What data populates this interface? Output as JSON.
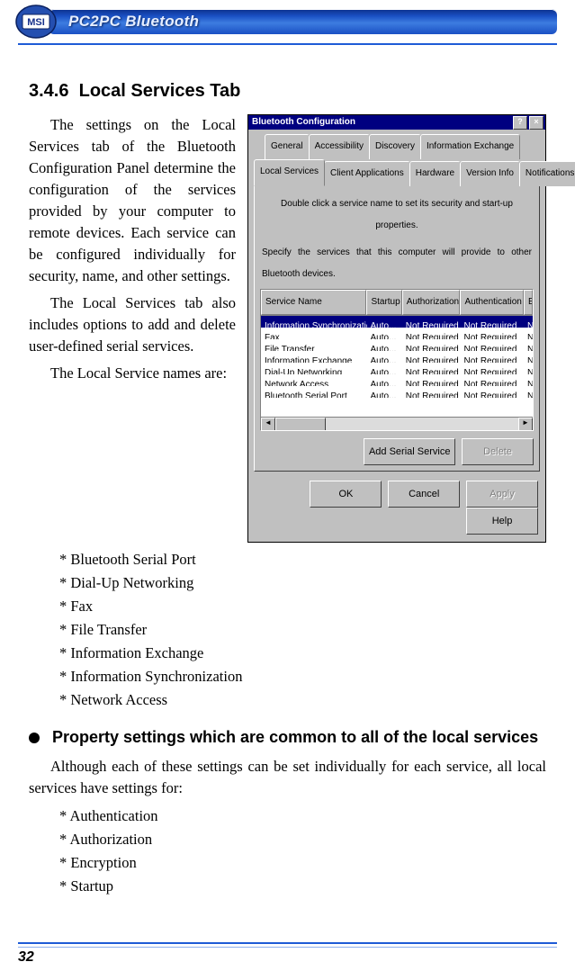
{
  "header": {
    "brand": "MSI",
    "title": "PC2PC Bluetooth"
  },
  "section": {
    "number": "3.4.6",
    "title": "Local Services Tab",
    "para1": "The settings on the Local Services tab of the Bluetooth Configuration Panel determine the configuration of the services provided by your computer to remote devices. Each service can be configured individually for security, name, and other settings.",
    "para2": "The Local Services tab also includes options to add and delete user-defined serial services.",
    "list_intro": "The Local Service names are:",
    "items": [
      "* Bluetooth Serial Port",
      "* Dial-Up Networking",
      "* Fax",
      "* File Transfer",
      "* Information Exchange",
      "* Information Synchronization",
      "* Network Access"
    ]
  },
  "subsection": {
    "title": "Property settings which are common to all of the local services",
    "para": "Although each of these settings can be set individually for each service, all local services have settings for:",
    "items": [
      "* Authentication",
      "* Authorization",
      "* Encryption",
      "* Startup"
    ]
  },
  "dialog": {
    "title": "Bluetooth Configuration",
    "help_btn": "?",
    "close_btn": "×",
    "tabs_back": [
      "General",
      "Accessibility",
      "Discovery",
      "Information Exchange"
    ],
    "tabs_front": [
      "Local Services",
      "Client Applications",
      "Hardware",
      "Version Info",
      "Notifications"
    ],
    "active_tab": "Local Services",
    "instr": "Double click a service name to set its security and start-up properties.",
    "instr2": "Specify the services that this computer will provide to other Bluetooth devices.",
    "columns": [
      "Service Name",
      "Startup",
      "Authorization",
      "Authentication",
      "E"
    ],
    "rows": [
      {
        "name": "Information Synchronization",
        "startup": "Auto...",
        "authz": "Not Required",
        "authn": "Not Required",
        "e": "N",
        "selected": true
      },
      {
        "name": "Fax",
        "startup": "Auto...",
        "authz": "Not Required",
        "authn": "Not Required",
        "e": "N"
      },
      {
        "name": "File Transfer",
        "startup": "Auto...",
        "authz": "Not Required",
        "authn": "Not Required",
        "e": "N"
      },
      {
        "name": "Information Exchange",
        "startup": "Auto...",
        "authz": "Not Required",
        "authn": "Not Required",
        "e": "N"
      },
      {
        "name": "Dial-Up Networking",
        "startup": "Auto...",
        "authz": "Not Required",
        "authn": "Not Required",
        "e": "N"
      },
      {
        "name": "Network Access",
        "startup": "Auto...",
        "authz": "Not Required",
        "authn": "Not Required",
        "e": "N"
      },
      {
        "name": "Bluetooth Serial Port",
        "startup": "Auto...",
        "authz": "Not Required",
        "authn": "Not Required",
        "e": "N"
      }
    ],
    "scroll_left": "◄",
    "scroll_right": "►",
    "panel_buttons": {
      "add": "Add Serial Service",
      "delete": "Delete"
    },
    "buttons": {
      "ok": "OK",
      "cancel": "Cancel",
      "apply": "Apply",
      "help": "Help"
    }
  },
  "page_number": "32"
}
